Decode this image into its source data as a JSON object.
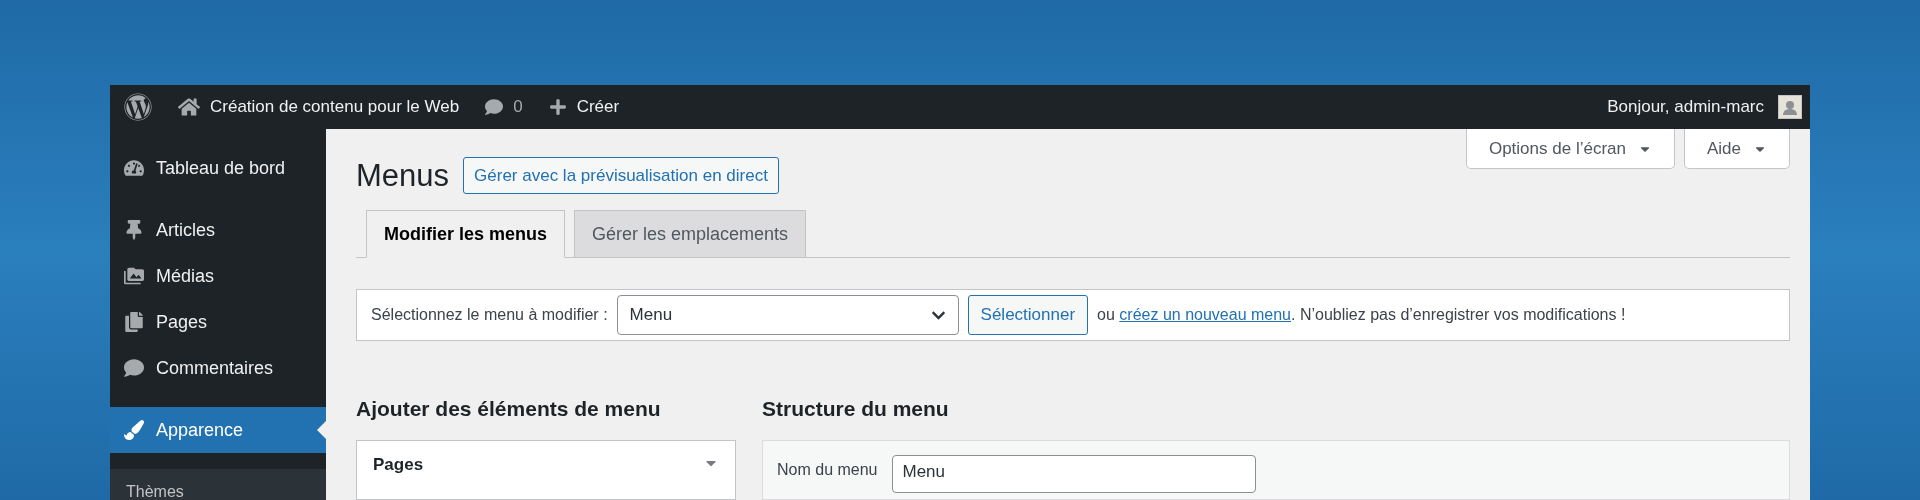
{
  "admin_bar": {
    "site_name": "Création de contenu pour le Web",
    "comments_count": "0",
    "new_label": "Créer",
    "greeting": "Bonjour, admin-marc"
  },
  "sidebar": {
    "groups": [
      [
        {
          "label": "Tableau de bord",
          "selected": false
        }
      ],
      [
        {
          "label": "Articles",
          "selected": false
        },
        {
          "label": "Médias",
          "selected": false
        },
        {
          "label": "Pages",
          "selected": false
        },
        {
          "label": "Commentaires",
          "selected": false
        }
      ],
      [
        {
          "label": "Apparence",
          "selected": true
        }
      ]
    ],
    "submenu": [
      {
        "label": "Thèmes",
        "selected": false
      }
    ]
  },
  "page": {
    "title": "Menus",
    "live_preview_button": "Gérer avec la prévisualisation en direct",
    "screen_options": "Options de l’écran",
    "help": "Aide",
    "tabs": [
      {
        "label": "Modifier les menus",
        "selected": true
      },
      {
        "label": "Gérer les emplacements",
        "selected": false
      }
    ],
    "menu_select": {
      "label": "Sélectionnez le menu à modifier :",
      "value": "Menu",
      "button": "Sélectionner",
      "text_before": "ou",
      "link": "créez un nouveau menu",
      "text_after": ". N’oubliez pas d’enregistrer vos modifications !"
    },
    "add_items": {
      "heading": "Ajouter des éléments de menu",
      "sections": [
        {
          "title": "Pages"
        }
      ]
    },
    "structure": {
      "heading": "Structure du menu",
      "name_label": "Nom du menu",
      "name_value": "Menu"
    }
  }
}
